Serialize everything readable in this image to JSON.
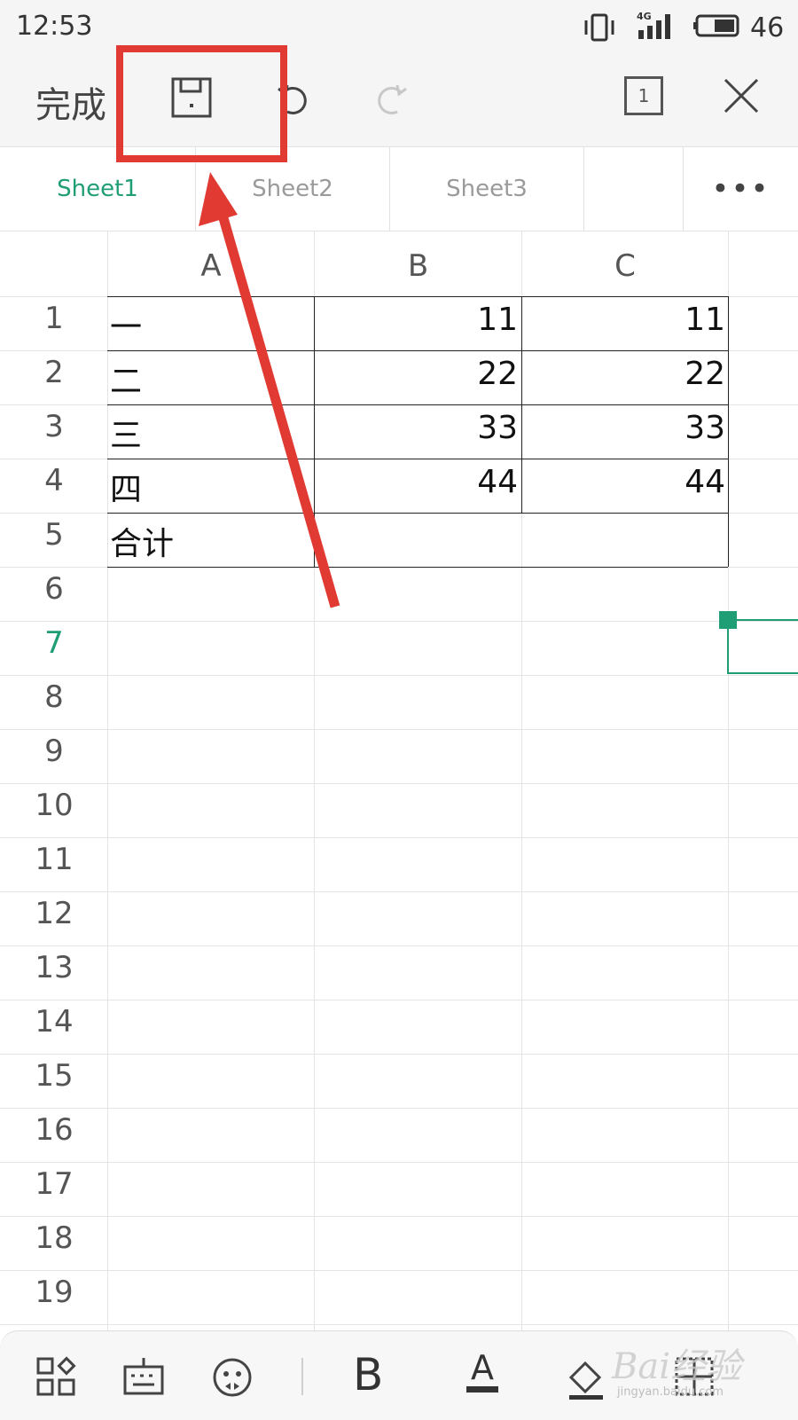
{
  "status_bar": {
    "time": "12:53",
    "network": "4G",
    "battery": "46"
  },
  "toolbar": {
    "done_label": "完成",
    "page_count": "1"
  },
  "tabs": {
    "sheets": [
      "Sheet1",
      "Sheet2",
      "Sheet3"
    ],
    "more": "•••",
    "active": "Sheet1"
  },
  "grid": {
    "columns": [
      "A",
      "B",
      "C"
    ],
    "row_numbers": [
      "1",
      "2",
      "3",
      "4",
      "5",
      "6",
      "7",
      "8",
      "9",
      "10",
      "11",
      "12",
      "13",
      "14",
      "15",
      "16",
      "17",
      "18",
      "19"
    ],
    "selected_row": "7",
    "rows": [
      {
        "a": "一",
        "b": "11",
        "c": "11"
      },
      {
        "a": "二",
        "b": "22",
        "c": "22"
      },
      {
        "a": "三",
        "b": "33",
        "c": "33"
      },
      {
        "a": "四",
        "b": "44",
        "c": "44"
      },
      {
        "a": "合计",
        "b": "",
        "c": ""
      }
    ]
  },
  "bottom_bar": {
    "bold": "B",
    "font_color": "A"
  },
  "watermark": {
    "brand": "Bai经验",
    "url": "jingyan.baidu.com"
  },
  "colors": {
    "accent": "#1f9e76",
    "annotation": "#e03a33"
  }
}
